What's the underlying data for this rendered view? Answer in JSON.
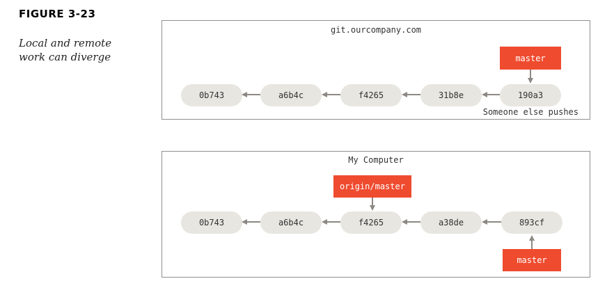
{
  "figure": {
    "label": "FIGURE 3-23",
    "caption": "Local and remote work can diverge"
  },
  "remote": {
    "title": "git.ourcompany.com",
    "note": "Someone else pushes",
    "commits": [
      "0b743",
      "a6b4c",
      "f4265",
      "31b8e",
      "190a3"
    ],
    "master_label": "master"
  },
  "local": {
    "title": "My Computer",
    "commits": [
      "0b743",
      "a6b4c",
      "f4265",
      "a38de",
      "893cf"
    ],
    "origin_master_label": "origin/master",
    "master_label": "master"
  },
  "colors": {
    "ref_fill": "#ef4b2f",
    "commit_fill": "#e8e6e0",
    "arrow": "#8c8984"
  }
}
